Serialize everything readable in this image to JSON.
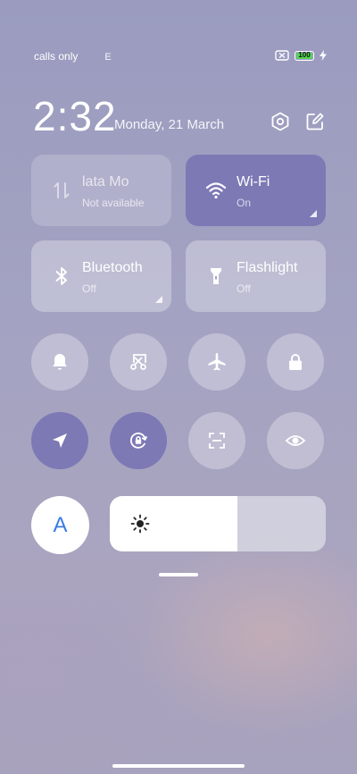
{
  "status_bar": {
    "network_text": "calls only",
    "network_type": "E",
    "battery_level": "100",
    "charging_icon": "bolt-icon",
    "sim_icon": "no-sim-icon",
    "battery_color": "#54d456"
  },
  "header": {
    "time": "2:32",
    "date": "Monday, 21 March",
    "settings_icon": "hexagon-settings-icon",
    "edit_icon": "edit-icon"
  },
  "tiles": [
    {
      "title": "lata      Mo",
      "subtitle": "Not available",
      "icon": "mobile-data-icon",
      "state": "unavailable"
    },
    {
      "title": "Wi-Fi",
      "subtitle": "On",
      "icon": "wifi-icon",
      "state": "on"
    },
    {
      "title": "Bluetooth",
      "subtitle": "Off",
      "icon": "bluetooth-icon",
      "state": "off"
    },
    {
      "title": "Flashlight",
      "subtitle": "Off",
      "icon": "flashlight-icon",
      "state": "off"
    }
  ],
  "toggles_row1": [
    {
      "icon": "bell-icon",
      "active": false
    },
    {
      "icon": "screenshot-icon",
      "active": false
    },
    {
      "icon": "airplane-icon",
      "active": false
    },
    {
      "icon": "lock-icon",
      "active": false
    }
  ],
  "toggles_row2": [
    {
      "icon": "location-icon",
      "active": true
    },
    {
      "icon": "rotation-lock-icon",
      "active": true
    },
    {
      "icon": "scanner-icon",
      "active": false
    },
    {
      "icon": "eye-icon",
      "active": false
    }
  ],
  "brightness": {
    "auto_label": "A",
    "level": 0.59,
    "icon": "sun-icon"
  },
  "colors": {
    "accent": "#7d79b5",
    "auto_text": "#3a7be8"
  }
}
